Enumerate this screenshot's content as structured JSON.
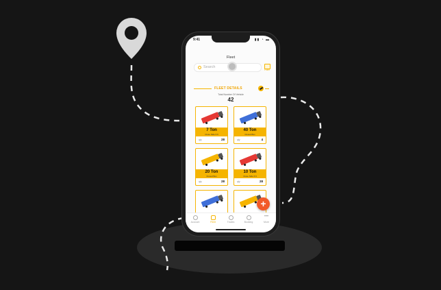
{
  "status": {
    "time": "9:41",
    "icons": "▮▮ ◔ ▬"
  },
  "header": {
    "title": "Fleet"
  },
  "search": {
    "placeholder": "Search"
  },
  "filter": {
    "label": "Filter"
  },
  "section": {
    "title": "FLEET DETAILS",
    "total_label": "Total Number Of Vehicle",
    "total_count": "42"
  },
  "cards": [
    {
      "tons": "7 Ton",
      "subtitle": "Close Side 6 ft",
      "foot_label": "qty",
      "foot_value": "28",
      "truck_color": "#e53935"
    },
    {
      "tons": "40 Ton",
      "subtitle": "Closed Box",
      "foot_label": "qty",
      "foot_value": "4",
      "truck_color": "#3f6fd8"
    },
    {
      "tons": "20 Ton",
      "subtitle": "Closed Box",
      "foot_label": "qty",
      "foot_value": "28",
      "truck_color": "#f5b400"
    },
    {
      "tons": "10 Ton",
      "subtitle": "Close Side 6 ft",
      "foot_label": "qty",
      "foot_value": "28",
      "truck_color": "#e53935"
    },
    {
      "tons": "",
      "subtitle": "",
      "foot_label": "",
      "foot_value": "",
      "truck_color": "#3f6fd8"
    },
    {
      "tons": "",
      "subtitle": "",
      "foot_label": "",
      "foot_value": "",
      "truck_color": "#f5b400"
    }
  ],
  "fab": {
    "label": "+"
  },
  "tabs": [
    {
      "label": "Account",
      "icon": "account-icon"
    },
    {
      "label": "Fleet",
      "icon": "truck-icon",
      "active": true
    },
    {
      "label": "Trades",
      "icon": "trades-icon"
    },
    {
      "label": "Booking",
      "icon": "booking-icon"
    },
    {
      "label": "More",
      "icon": "more-icon"
    }
  ],
  "colors": {
    "accent": "#f5b400",
    "fab": "#f25a28",
    "background": "#151515",
    "pin": "#d9d9d9"
  }
}
